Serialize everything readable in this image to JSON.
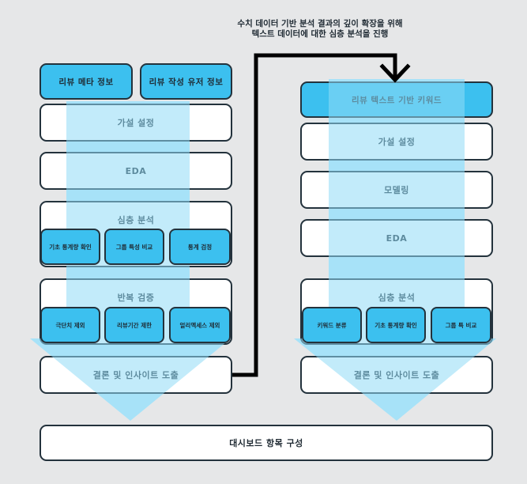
{
  "note": {
    "line1": "수치 데이터 기반 분석 결과의 깊이 확장을 위해",
    "line2": "텍스트 데이터에 대한 심층 분석을 진행"
  },
  "left": {
    "meta_info": "리뷰 메타 정보",
    "author_info": "리뷰 작성 유저 정보",
    "hypothesis": "가설 설정",
    "eda": "EDA",
    "deep_analysis": {
      "title": "심층 분석",
      "items": [
        "기초 통계량 확인",
        "그룹 특성 비교",
        "통계 검정"
      ]
    },
    "repeat_validation": {
      "title": "반복 검증",
      "items": [
        "극단치 제외",
        "리뷰기간 제한",
        "얼리액세스 제외"
      ]
    },
    "conclusion": "결론 및 인사이트 도출"
  },
  "right": {
    "keyword": "리뷰 텍스트 기반 키워드",
    "hypothesis": "가설 설정",
    "modeling": "모델링",
    "eda": "EDA",
    "deep_analysis": {
      "title": "심층 분석",
      "items": [
        "키워드 분류",
        "기초 통계량 확인",
        "그룹 특 비교"
      ]
    },
    "conclusion": "결론 및 인사이트 도출"
  },
  "dashboard": "대시보드 항목 구성",
  "colors": {
    "background": "#e6e7e8",
    "accent_blue": "#3cc0ef",
    "flow_light_blue": "#c3ecfb",
    "border": "#23323c"
  }
}
